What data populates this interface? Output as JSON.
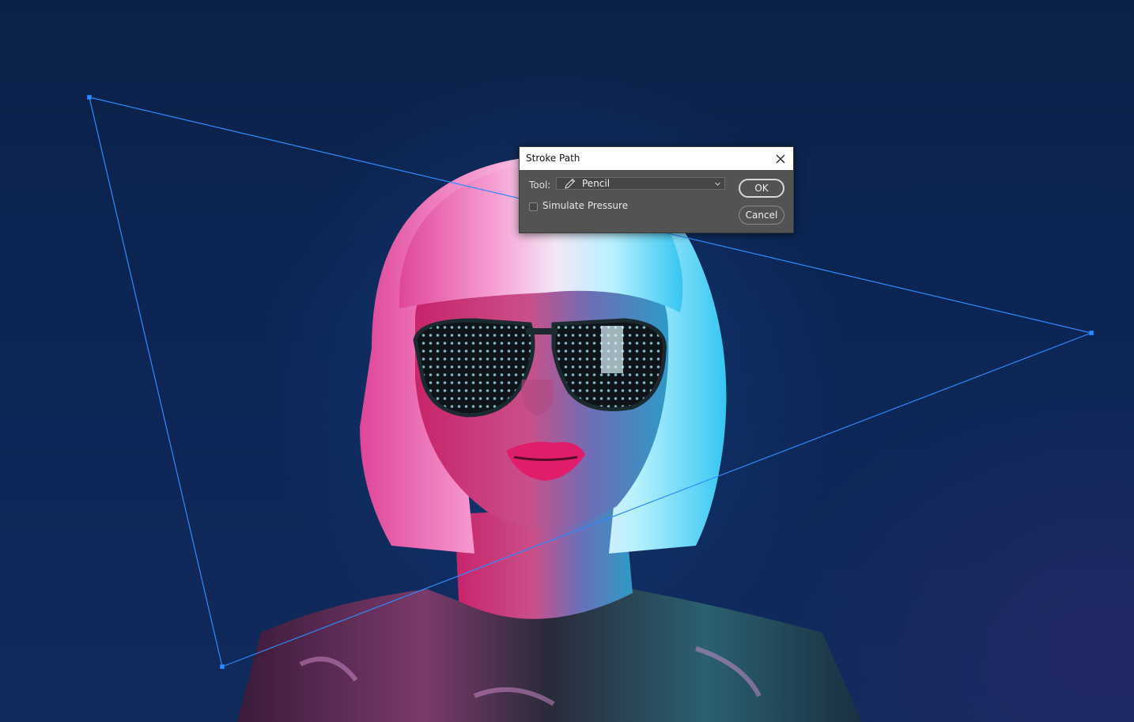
{
  "dialog": {
    "title": "Stroke Path",
    "tool_label": "Tool:",
    "tool_value": "Pencil",
    "simulate_pressure_label": "Simulate Pressure",
    "simulate_pressure_checked": false,
    "ok_label": "OK",
    "cancel_label": "Cancel"
  },
  "icons": {
    "close": "close-icon",
    "tool": "pencil-icon",
    "dropdown": "chevron-down-icon"
  },
  "colors": {
    "path": "#2f8bff",
    "dialog_bg": "#535353",
    "titlebar_bg": "#ffffff"
  }
}
